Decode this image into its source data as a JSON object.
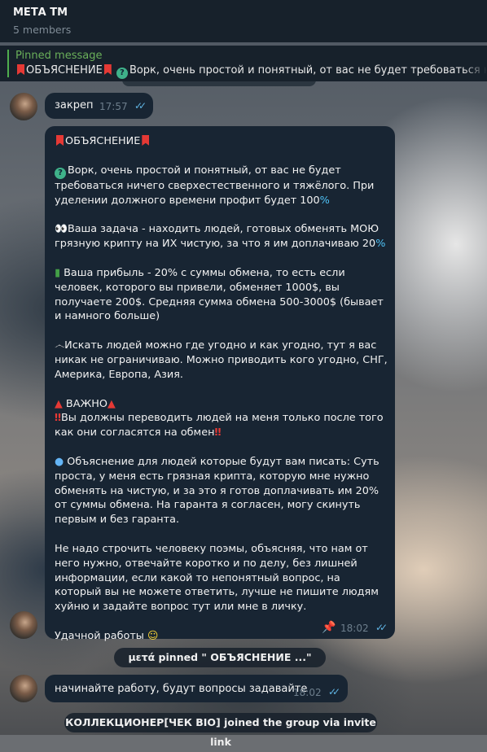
{
  "header": {
    "title": "МЕТА ТМ",
    "subtitle": "5 members"
  },
  "pinned": {
    "label": "Pinned message",
    "preview": "ОБЪЯСНЕНИЕ",
    "preview_rest": "Ворк, очень простой и понятный, от вас не будет требоваться ниче"
  },
  "messages": [
    {
      "text": "закреп",
      "time": "17:57"
    },
    {
      "title": "ОБЪЯСНЕНИЕ",
      "paragraphs": [
        "Ворк, очень простой и понятный, от вас не будет требоваться ничего сверхестественного и тяжёлого. При уделении должного времени профит будет 100",
        "Ваша задача - находить людей, готовых обменять МОЮ грязную крипту на ИХ чистую, за что я им доплачиваю 20",
        "Ваша прибыль - 20% с суммы обмена, то есть если человек, которого вы привели, обменяет 1000$, вы получаете 200$. Средняя сумма обмена 500-3000$ (бывает и намного больше)",
        "Искать людей можно где угодно и как угодно, тут я вас никак не ограничиваю. Можно приводить кого угодно, СНГ,  Америка, Европа, Азия.",
        "ВАЖНО",
        "Вы должны переводить людей на меня только после того как они согласятся на обмен",
        "Объяснение для людей которые будут вам писать: Суть проста, у меня есть грязная крипта, которую мне нужно обменять на чистую, и за это я готов доплачивать им 20% от суммы обмена. На гаранта я согласен, могу скинуть первым и без гаранта.",
        "Не надо строчить человеку поэмы, объясняя,  что нам от него нужно, отвечайте коротко и по делу, без лишней информации, если какой то непонятный вопрос, на который вы не можете ответить, лучше не пишите людям хуйню и задайте вопрос тут или мне в личку.",
        "Удачной работы"
      ],
      "time": "18:02"
    },
    {
      "text": "начинайте работу, будут вопросы задавайте",
      "time": "18:02"
    }
  ],
  "service": {
    "pin_notice": "μετά pinned \" ОБЪЯСНЕНИЕ  ...\"",
    "join_notice": "КОЛЛЕКЦИОНЕР[ЧЕК BIO] joined the group via invite link"
  },
  "icons": [
    "bookmark-icon",
    "question-icon",
    "eyes-icon",
    "money-icon",
    "mustache-icon",
    "warning-icon",
    "exclamation-icon",
    "speech-icon",
    "smile-icon",
    "pin-icon",
    "double-check-icon"
  ],
  "colors": {
    "header_bg": "#17212b",
    "bubble_bg": "#182533",
    "accent_green": "#6ab05a",
    "check_blue": "#5fb4e3"
  }
}
